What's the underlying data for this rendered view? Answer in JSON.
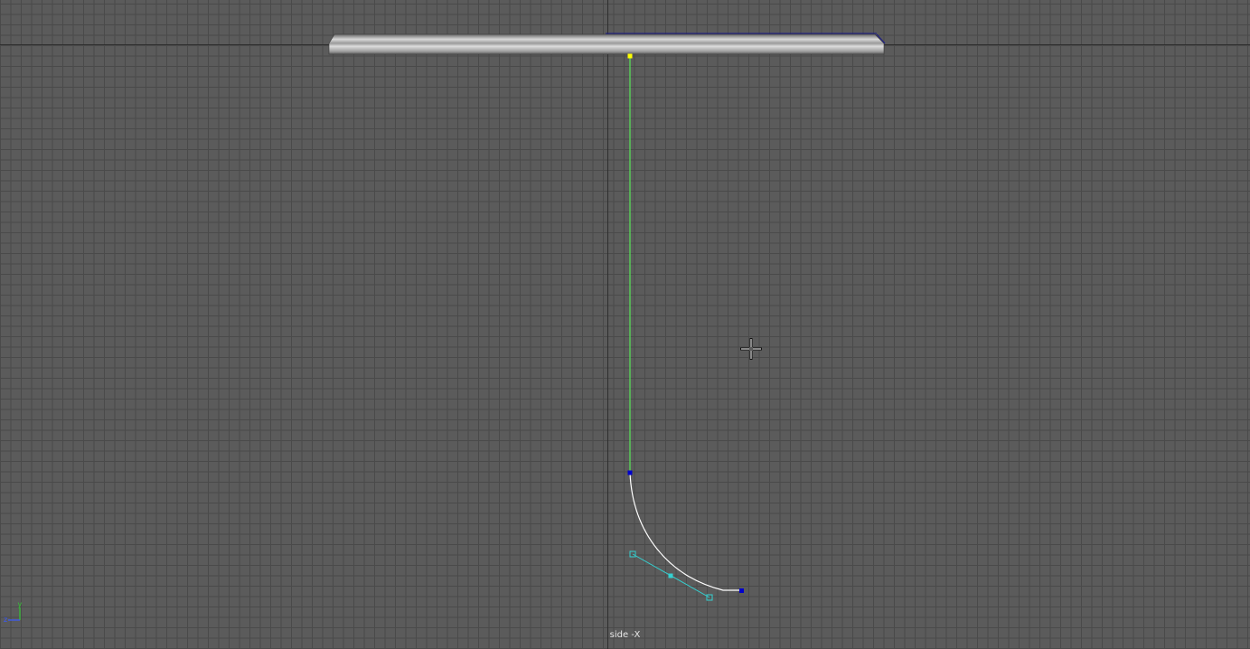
{
  "viewport": {
    "camera_label": "side -X",
    "background_color": "#5b5b5b",
    "grid_color": "#4a4a4a",
    "axis_color": "#2e2e2e"
  },
  "axis_gizmo": {
    "y_label": "y",
    "z_label": "z",
    "y_color": "#35c535",
    "z_color": "#3a5bff"
  },
  "scene": {
    "joint_highlight_color": "#ffff00",
    "joint_color": "#0000cc",
    "bone_color": "#58e458",
    "curve_color": "#ffffff",
    "selected_cv_color": "#35d0d0"
  },
  "icons": {
    "cursor": "crosshair-move-cursor-icon",
    "gizmo": "view-axis-icon"
  }
}
